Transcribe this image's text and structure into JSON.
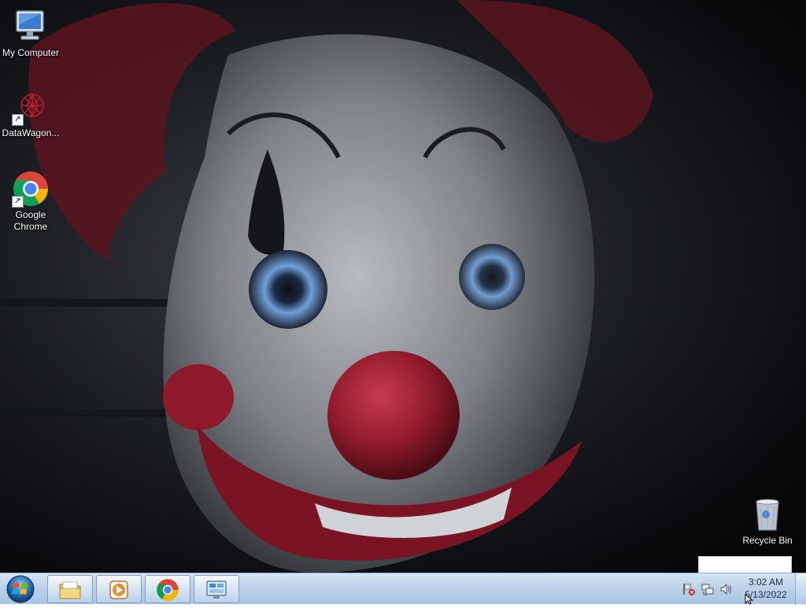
{
  "desktop": {
    "wallpaper": "clown-face-wallpaper",
    "icons": [
      {
        "label": "My Computer",
        "icon": "computer-icon"
      },
      {
        "label": "DataWagon...",
        "icon": "datawagon-icon",
        "shortcut": true
      },
      {
        "label": "Google Chrome",
        "icon": "chrome-icon",
        "shortcut": true
      },
      {
        "label": "Recycle Bin",
        "icon": "recycle-bin-icon"
      }
    ]
  },
  "taskbar": {
    "start_icon": "windows-logo-icon",
    "pinned": [
      {
        "name": "Windows Explorer",
        "icon": "folder-icon"
      },
      {
        "name": "Windows Media Player",
        "icon": "media-player-icon"
      },
      {
        "name": "Google Chrome",
        "icon": "chrome-icon"
      },
      {
        "name": "Server Manager",
        "icon": "server-manager-icon"
      }
    ],
    "tray_icons": [
      "action-center-flag-icon",
      "network-icon",
      "volume-icon"
    ],
    "clock": {
      "time": "3:02 AM",
      "date": "5/13/2022"
    }
  },
  "colors": {
    "taskbar_top": "#d6e4f3",
    "taskbar_bottom": "#a9c4e2",
    "clown_red": "#9c1b2c",
    "eye_blue": "#4f7fc0"
  }
}
